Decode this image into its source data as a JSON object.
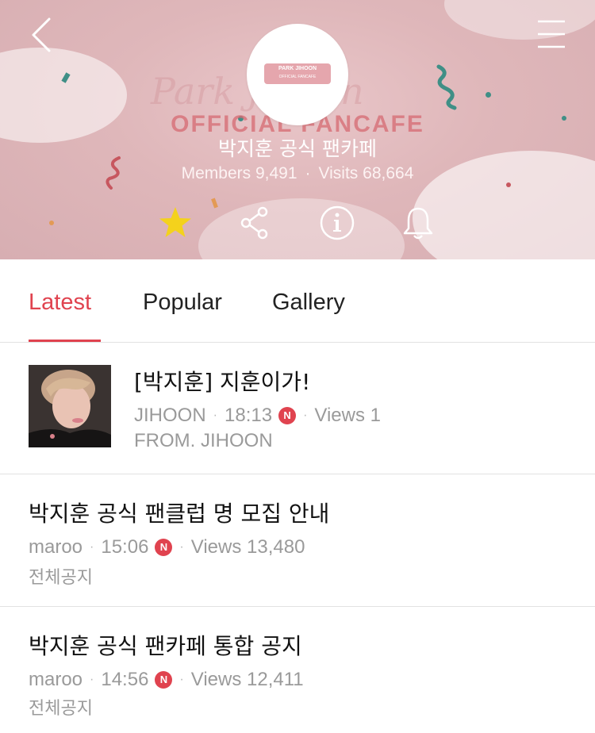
{
  "header": {
    "banner_script": "Park Jihoon",
    "banner_logo": "OFFICIAL FANCAFE",
    "avatar_line1": "PARK JIHOON",
    "avatar_line2": "OFFICIAL FANCAFE",
    "title": "박지훈 공식 팬카페",
    "members_label": "Members 9,491",
    "separator": "·",
    "visits_label": "Visits 68,664",
    "actions": [
      "star-icon",
      "share-icon",
      "info-icon",
      "bell-icon"
    ],
    "star_color": "#f4d21c"
  },
  "tabs": [
    {
      "label": "Latest",
      "active": true
    },
    {
      "label": "Popular",
      "active": false
    },
    {
      "label": "Gallery",
      "active": false
    }
  ],
  "accent_color": "#e0434f",
  "posts": [
    {
      "title": "[박지훈] 지훈이가!",
      "author": "JIHOON",
      "time": "18:13",
      "badge": "N",
      "views": "Views 1",
      "board": "FROM. JIHOON",
      "has_thumbnail": true
    },
    {
      "title": "박지훈 공식 팬클럽 명 모집 안내",
      "author": "maroo",
      "time": "15:06",
      "badge": "N",
      "views": "Views 13,480",
      "board": "전체공지",
      "has_thumbnail": false
    },
    {
      "title": "박지훈 공식 팬카페 통합 공지",
      "author": "maroo",
      "time": "14:56",
      "badge": "N",
      "views": "Views 12,411",
      "board": "전체공지",
      "has_thumbnail": false
    }
  ]
}
